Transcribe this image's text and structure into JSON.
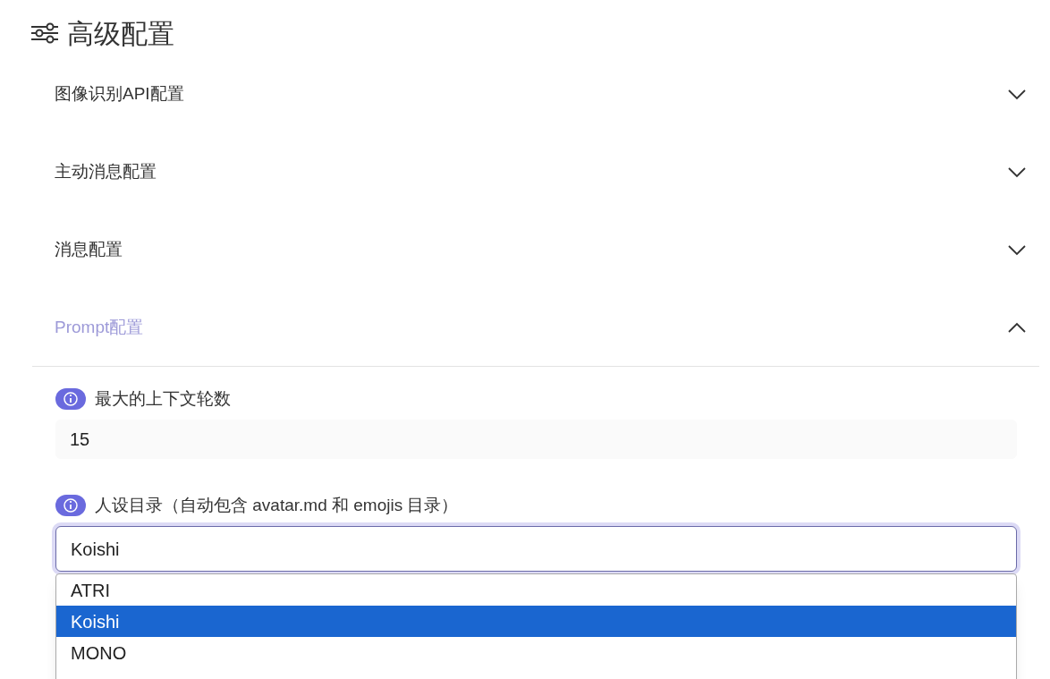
{
  "header": {
    "title": "高级配置"
  },
  "sections": [
    {
      "title": "图像识别API配置",
      "expanded": false
    },
    {
      "title": "主动消息配置",
      "expanded": false
    },
    {
      "title": "消息配置",
      "expanded": false
    },
    {
      "title": "Prompt配置",
      "expanded": true
    }
  ],
  "prompt_fields": [
    {
      "kind": "number",
      "label": "最大的上下文轮数",
      "value": "15"
    },
    {
      "kind": "select",
      "label": "人设目录（自动包含 avatar.md 和 emojis 目录）",
      "value": "Koishi"
    }
  ],
  "dropdown": {
    "options": [
      {
        "label": "ATRI",
        "selected": false
      },
      {
        "label": "Koishi",
        "selected": true
      },
      {
        "label": "MONO",
        "selected": false
      }
    ]
  }
}
